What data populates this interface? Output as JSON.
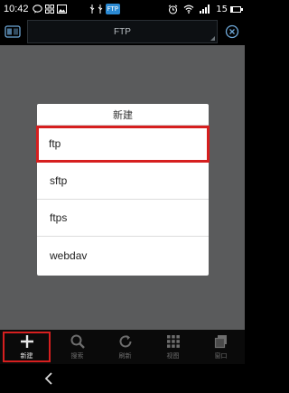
{
  "status_bar": {
    "time": "10:42",
    "ftp_badge": "FTP",
    "battery_level": "15",
    "battery_fraction": 0.15,
    "icons": [
      "message-icon",
      "grid-icon",
      "image-icon",
      "usb-icon",
      "alarm-icon",
      "wifi-icon",
      "signal-icon",
      "battery-icon"
    ]
  },
  "appbar": {
    "title": "FTP",
    "left_icon": "server-icon",
    "right_icon": "close-icon"
  },
  "dialog": {
    "title": "新建",
    "options": [
      {
        "label": "ftp",
        "highlighted": true
      },
      {
        "label": "sftp",
        "highlighted": false
      },
      {
        "label": "ftps",
        "highlighted": false
      },
      {
        "label": "webdav",
        "highlighted": false
      }
    ]
  },
  "toolbar": {
    "items": [
      {
        "label": "新建",
        "icon": "plus-icon",
        "active": true
      },
      {
        "label": "搜索",
        "icon": "search-icon",
        "active": false
      },
      {
        "label": "刷新",
        "icon": "refresh-icon",
        "active": false
      },
      {
        "label": "视图",
        "icon": "grid-view-icon",
        "active": false
      },
      {
        "label": "窗口",
        "icon": "window-icon",
        "active": false
      }
    ]
  },
  "navbar": {
    "back_icon": "back-icon"
  },
  "colors": {
    "highlight": "#d61f1f",
    "ftp_badge": "#2b8ad3",
    "overlay": "#5a5b5c"
  }
}
